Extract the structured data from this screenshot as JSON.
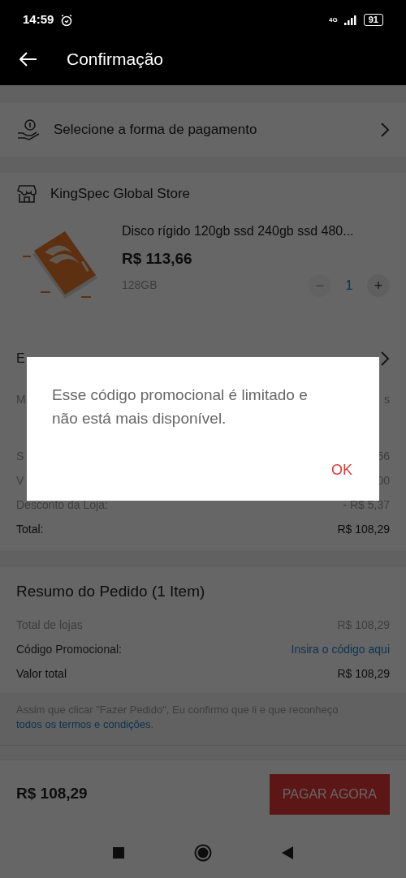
{
  "status_bar": {
    "time": "14:59",
    "network": "4G",
    "battery": "91"
  },
  "header": {
    "title": "Confirmação"
  },
  "payment": {
    "label": "Selecione a forma de pagamento"
  },
  "store": {
    "name": "KingSpec Global Store",
    "product": {
      "kind": "picture",
      "title": "Disco rígido 120gb ssd 240gb ssd 480...",
      "price": "R$ 113,66",
      "variant": "128GB",
      "decrease": "−",
      "quantity": "1",
      "increase": "+"
    },
    "rows": [
      {
        "kind": "link",
        "label": "E"
      },
      {
        "kind": "muted",
        "label": "M",
        "value": "s"
      },
      {
        "kind": "muted",
        "label": "S",
        "value": "56"
      },
      {
        "kind": "muted",
        "label": "V",
        "value": "00"
      },
      {
        "kind": "muted",
        "label": "Desconto da Loja:",
        "value": "- R$ 5,37"
      },
      {
        "kind": "total",
        "label": "Total:",
        "value": "R$ 108,29"
      }
    ]
  },
  "summary": {
    "title": "Resumo do Pedido (1 Item)",
    "rows": [
      {
        "kind": "muted",
        "label": "Total de lojas",
        "value": "R$ 108,29"
      },
      {
        "kind": "link",
        "label": "Código Promocional:",
        "value": "Insira o código aqui"
      },
      {
        "kind": "total",
        "label": "Valor total",
        "value": "R$ 108,29"
      }
    ],
    "terms": {
      "text": "Assim que clicar \"Fazer Pedido\", Eu confirmo que li e que reconheço",
      "link": "todos os termos e condições",
      "end": "."
    }
  },
  "footer": {
    "total": "R$ 108,29",
    "button": "PAGAR AGORA"
  },
  "dialog": {
    "message": "Esse código promocional é limitado e não está mais disponível.",
    "button": "OK"
  }
}
